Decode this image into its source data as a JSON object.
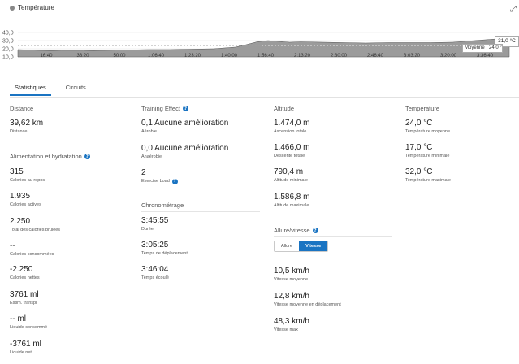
{
  "chart": {
    "legend": "Température",
    "y_ticks": [
      "40,0",
      "30,0",
      "20,0",
      "10,0"
    ],
    "x_ticks": [
      "16:40",
      "33:20",
      "50:00",
      "1:06:40",
      "1:23:20",
      "1:40:00",
      "1:56:40",
      "2:13:20",
      "2:30:00",
      "2:46:40",
      "3:03:20",
      "3:20:00",
      "3:36:40"
    ],
    "tooltip": "31,0 °C",
    "average_label": "Moyenne · 24,0 °C",
    "fill_color": "#9b9b9b",
    "line_color": "#555555"
  },
  "chart_data": {
    "type": "area",
    "title": "Température",
    "ylim": [
      10,
      40
    ],
    "y_average": 24,
    "x_minutes": [
      0,
      10,
      20,
      30,
      40,
      50,
      60,
      70,
      80,
      90,
      100,
      105,
      110,
      115,
      120,
      125,
      130,
      140,
      150,
      160,
      170,
      180,
      190,
      200,
      205,
      210,
      215,
      220,
      226
    ],
    "values": [
      19,
      18,
      17.5,
      17.5,
      18,
      18.5,
      19,
      19,
      19.5,
      20,
      22,
      25,
      28.5,
      30,
      29,
      28,
      28.5,
      28,
      27.5,
      27,
      27.5,
      27.5,
      27.5,
      28,
      29,
      30,
      31,
      32,
      31
    ]
  },
  "tabs": [
    {
      "label": "Statistiques",
      "active": true
    },
    {
      "label": "Circuits",
      "active": false
    }
  ],
  "col1": {
    "distance": {
      "title": "Distance",
      "value": "39,62 km",
      "label": "Distance"
    },
    "nutrition": {
      "title": "Alimentation et hydratation",
      "stats": [
        {
          "value": "315",
          "label": "Calories au repos"
        },
        {
          "value": "1.935",
          "label": "Calories actives"
        },
        {
          "value": "2.250",
          "label": "Total des calories brûlées"
        },
        {
          "value": "--",
          "label": "Calories consommées"
        },
        {
          "value": "-2.250",
          "label": "Calories nettes"
        },
        {
          "value": "3761 ml",
          "label": "Estim. transpi"
        },
        {
          "value": "-- ml",
          "label": "Liquide consommé"
        },
        {
          "value": "-3761 ml",
          "label": "Liquide net"
        }
      ]
    }
  },
  "col2": {
    "training": {
      "title": "Training Effect",
      "stats": [
        {
          "value": "0,1 Aucune amélioration",
          "label": "Aérobie"
        },
        {
          "value": "0,0 Aucune amélioration",
          "label": "Anaérobie"
        },
        {
          "value": "2",
          "label": "Exercise Load"
        }
      ]
    },
    "chrono": {
      "title": "Chronométrage",
      "stats": [
        {
          "value": "3:45:55",
          "label": "Durée"
        },
        {
          "value": "3:05:25",
          "label": "Temps de déplacement"
        },
        {
          "value": "3:46:04",
          "label": "Temps écoulé"
        }
      ]
    }
  },
  "col3": {
    "altitude": {
      "title": "Altitude",
      "stats": [
        {
          "value": "1.474,0 m",
          "label": "Ascension totale"
        },
        {
          "value": "1.466,0 m",
          "label": "Descente totale"
        },
        {
          "value": "790,4 m",
          "label": "Altitude minimale"
        },
        {
          "value": "1.586,8 m",
          "label": "Altitude maximale"
        }
      ]
    },
    "pace": {
      "title": "Allure/vitesse",
      "toggle": [
        "Allure",
        "Vitesse"
      ],
      "stats": [
        {
          "value": "10,5 km/h",
          "label": "Vitesse moyenne"
        },
        {
          "value": "12,8 km/h",
          "label": "Vitesse moyenne en déplacement"
        },
        {
          "value": "48,3 km/h",
          "label": "Vitesse max"
        }
      ]
    }
  },
  "col4": {
    "temperature": {
      "title": "Température",
      "stats": [
        {
          "value": "24,0 °C",
          "label": "Température moyenne"
        },
        {
          "value": "17,0 °C",
          "label": "Température minimale"
        },
        {
          "value": "32,0 °C",
          "label": "Température maximale"
        }
      ]
    }
  }
}
